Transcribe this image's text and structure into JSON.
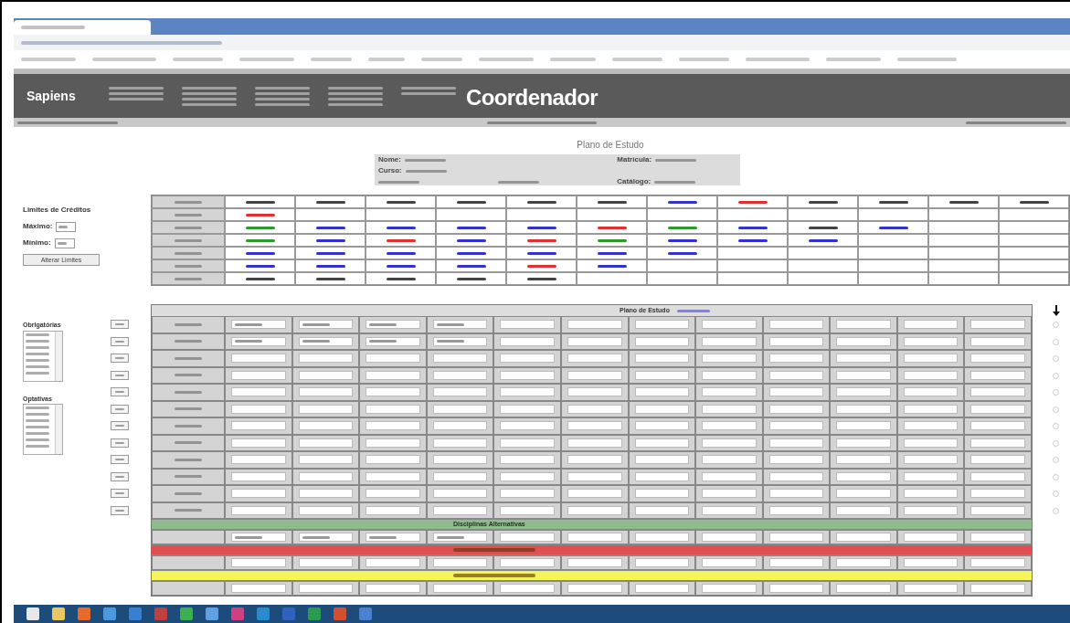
{
  "header": {
    "logo": "Sapiens",
    "title": "Coordenador"
  },
  "page_title": "Plano de Estudo",
  "student_info": {
    "labels": [
      "Nome:",
      "Curso:",
      "Matrícula:",
      "Catálogo:"
    ]
  },
  "credit_limits": {
    "title": "Limites de Créditos",
    "fields": [
      "Máximo:",
      "Mínimo:"
    ],
    "button": "Alterar Limites"
  },
  "lists": [
    {
      "title": "Obrigatórias"
    },
    {
      "title": "Optativas"
    }
  ],
  "history_table": {
    "rows": [
      {
        "cells": [
          {
            "color": "#444444"
          },
          {
            "color": "#444444"
          },
          {
            "color": "#444444"
          },
          {
            "color": "#444444"
          },
          {
            "color": "#444444"
          },
          {
            "color": "#444444"
          },
          {
            "color": "#3333cc"
          },
          {
            "color": "#e03030"
          },
          {
            "color": "#444444"
          },
          {
            "color": "#444444"
          },
          {
            "color": "#444444"
          },
          {
            "color": "#444444"
          }
        ]
      },
      {
        "cells": [
          {
            "color": "#e03030"
          }
        ]
      },
      {
        "cells": [
          {
            "color": "#2e9a2e"
          },
          {
            "color": "#3333cc"
          },
          {
            "color": "#3333cc"
          },
          {
            "color": "#3333cc"
          },
          {
            "color": "#3333cc"
          },
          {
            "color": "#e03030"
          },
          {
            "color": "#2e9a2e"
          },
          {
            "color": "#3333cc"
          },
          {
            "color": "#444444"
          },
          {
            "color": "#3333cc"
          }
        ]
      },
      {
        "cells": [
          {
            "color": "#2e9a2e"
          },
          {
            "color": "#3333cc"
          },
          {
            "color": "#e03030"
          },
          {
            "color": "#3333cc"
          },
          {
            "color": "#e03030"
          },
          {
            "color": "#2e9a2e"
          },
          {
            "color": "#3333cc"
          },
          {
            "color": "#3333cc"
          },
          {
            "color": "#3333cc"
          }
        ]
      },
      {
        "cells": [
          {
            "color": "#3333cc"
          },
          {
            "color": "#3333cc"
          },
          {
            "color": "#3333cc"
          },
          {
            "color": "#3333cc"
          },
          {
            "color": "#3333cc"
          },
          {
            "color": "#3333cc"
          },
          {
            "color": "#3333cc"
          }
        ]
      },
      {
        "cells": [
          {
            "color": "#3333cc"
          },
          {
            "color": "#3333cc"
          },
          {
            "color": "#3333cc"
          },
          {
            "color": "#3333cc"
          },
          {
            "color": "#e03030"
          },
          {
            "color": "#3333cc"
          }
        ]
      },
      {
        "cells": [
          {
            "color": "#444444"
          },
          {
            "color": "#444444"
          },
          {
            "color": "#444444"
          },
          {
            "color": "#444444"
          },
          {
            "color": "#444444"
          }
        ]
      }
    ]
  },
  "plan_table": {
    "title": "Plano de Estudo",
    "rows": [
      {
        "kind": "term",
        "selected": false,
        "filled": [
          true,
          true,
          true,
          true,
          false,
          false,
          false,
          false,
          false,
          false,
          false,
          false
        ]
      },
      {
        "kind": "term",
        "selected": false,
        "filled": [
          true,
          true,
          true,
          true,
          false,
          false,
          false,
          false,
          false,
          false,
          false,
          false
        ]
      },
      {
        "kind": "term",
        "selected": false,
        "filled": [
          false,
          false,
          false,
          false,
          false,
          false,
          false,
          false,
          false,
          false,
          false,
          false
        ]
      },
      {
        "kind": "term",
        "selected": false,
        "filled": [
          false,
          false,
          false,
          false,
          false,
          false,
          false,
          false,
          false,
          false,
          false,
          false
        ]
      },
      {
        "kind": "term",
        "selected": false,
        "filled": [
          false,
          false,
          false,
          false,
          false,
          false,
          false,
          false,
          false,
          false,
          false,
          false
        ]
      },
      {
        "kind": "term",
        "selected": false,
        "filled": [
          false,
          false,
          false,
          false,
          false,
          false,
          false,
          false,
          false,
          false,
          false,
          false
        ]
      },
      {
        "kind": "term",
        "selected": false,
        "filled": [
          false,
          false,
          false,
          false,
          false,
          false,
          false,
          false,
          false,
          false,
          false,
          false
        ]
      },
      {
        "kind": "term",
        "selected": false,
        "filled": [
          false,
          false,
          false,
          false,
          false,
          false,
          false,
          false,
          false,
          false,
          false,
          false
        ]
      },
      {
        "kind": "term",
        "selected": false,
        "filled": [
          false,
          false,
          false,
          false,
          false,
          false,
          false,
          false,
          false,
          false,
          false,
          false
        ]
      },
      {
        "kind": "term",
        "selected": false,
        "filled": [
          false,
          false,
          false,
          false,
          false,
          false,
          false,
          false,
          false,
          false,
          false,
          false
        ]
      },
      {
        "kind": "term",
        "selected": false,
        "filled": [
          false,
          false,
          false,
          false,
          false,
          false,
          false,
          false,
          false,
          false,
          false,
          false
        ]
      },
      {
        "kind": "term",
        "selected": false,
        "filled": [
          false,
          false,
          false,
          false,
          false,
          false,
          false,
          false,
          false,
          false,
          false,
          false
        ]
      },
      {
        "kind": "band",
        "label": "Disciplinas Alternativas",
        "color": "#8fbc8f"
      },
      {
        "kind": "extra",
        "filled": [
          true,
          true,
          true,
          true,
          false,
          false,
          false,
          false,
          false,
          false,
          false,
          false
        ]
      },
      {
        "kind": "band",
        "color": "#e05050"
      },
      {
        "kind": "extra",
        "filled": [
          false,
          false,
          false,
          false,
          false,
          false,
          false,
          false,
          false,
          false,
          false,
          false
        ]
      },
      {
        "kind": "band",
        "color": "#f5f55a"
      },
      {
        "kind": "extra",
        "filled": [
          false,
          false,
          false,
          false,
          false,
          false,
          false,
          false,
          false,
          false,
          false,
          false
        ]
      }
    ]
  }
}
